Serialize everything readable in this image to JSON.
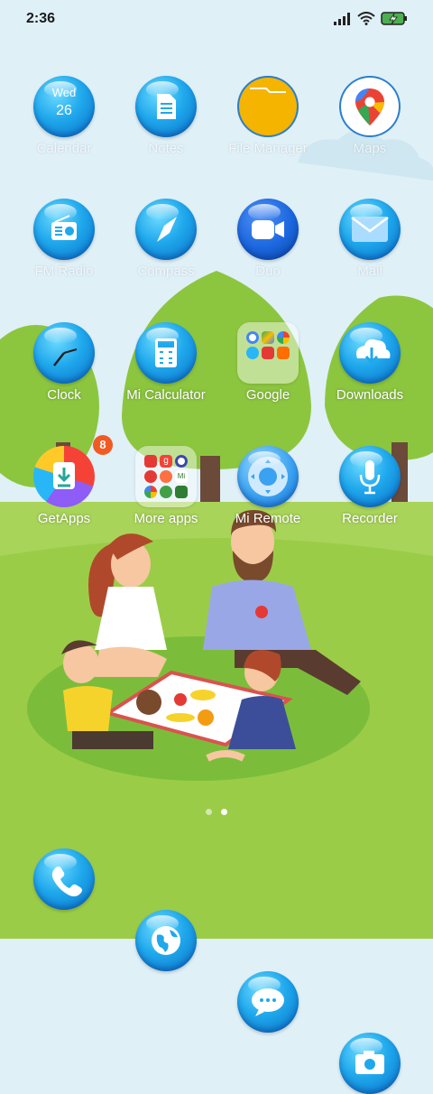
{
  "status_bar": {
    "time": "2:36"
  },
  "apps": [
    {
      "label": "Calendar",
      "icon": "calendar-icon",
      "calendar_day": "Wed",
      "calendar_date": "26"
    },
    {
      "label": "Notes",
      "icon": "notes-icon"
    },
    {
      "label": "File Manager",
      "icon": "folder-icon"
    },
    {
      "label": "Maps",
      "icon": "maps-pin-icon"
    },
    {
      "label": "FM Radio",
      "icon": "radio-icon"
    },
    {
      "label": "Compass",
      "icon": "compass-icon"
    },
    {
      "label": "Duo",
      "icon": "video-camera-icon"
    },
    {
      "label": "Mail",
      "icon": "mail-icon"
    },
    {
      "label": "Clock",
      "icon": "clock-icon"
    },
    {
      "label": "Mi Calculator",
      "icon": "calculator-icon"
    },
    {
      "label": "Google",
      "icon": "folder-icon"
    },
    {
      "label": "Downloads",
      "icon": "download-icon"
    },
    {
      "label": "GetApps",
      "icon": "getapps-icon",
      "badge": "8"
    },
    {
      "label": "More apps",
      "icon": "folder-icon"
    },
    {
      "label": "Mi Remote",
      "icon": "remote-icon"
    },
    {
      "label": "Recorder",
      "icon": "microphone-icon"
    }
  ],
  "folder_more_apps_tile_text": [
    "g",
    "Mi"
  ],
  "page_indicator": {
    "pages": 2,
    "current": 2
  },
  "dock": [
    {
      "icon": "phone-icon"
    },
    {
      "icon": "browser-globe-icon"
    },
    {
      "icon": "messages-icon"
    },
    {
      "icon": "camera-icon"
    }
  ],
  "colors": {
    "bubble": "#1fa8ec",
    "badge": "#f15a22",
    "grass": "#8cc63f",
    "sky": "#dff0f7"
  }
}
